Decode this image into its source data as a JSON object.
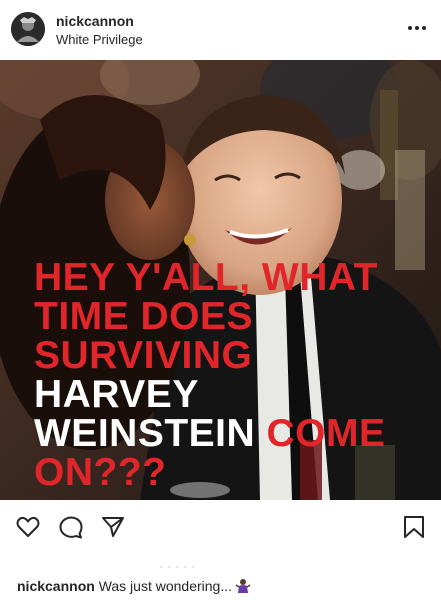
{
  "post": {
    "username": "nickcannon",
    "location": "White Privilege"
  },
  "overlay": {
    "line1": "HEY Y'ALL, WHAT",
    "line2": "TIME DOES",
    "line3": "SURVIVING",
    "line4": "HARVEY",
    "line5_white": "WEINSTEIN",
    "line5_red": "COME",
    "line6": "ON???",
    "colors": {
      "red": "#e0262b",
      "white": "#ffffff"
    }
  },
  "actions": {
    "like_icon": "heart-icon",
    "comment_icon": "comment-icon",
    "share_icon": "share-icon",
    "save_icon": "bookmark-icon"
  },
  "caption": {
    "username": "nickcannon",
    "text": "Was just wondering...",
    "emoji_icon": "person-shrugging-emoji"
  }
}
